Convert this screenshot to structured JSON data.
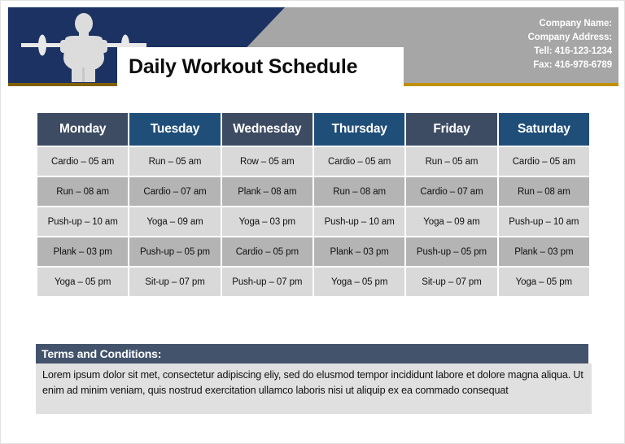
{
  "document": {
    "title": "Daily Workout Schedule"
  },
  "header": {
    "logo_icon": "weightlifter-barbell-icon",
    "company": {
      "name_label": "Company Name:",
      "address_label": "Company Address:",
      "tel": "Tell: 416-123-1234",
      "fax": "Fax: 416-978-6789"
    },
    "colors": {
      "navy": "#1b3263",
      "gray": "#a6a6a6",
      "gold": "#bf9000"
    }
  },
  "schedule": {
    "columns": [
      {
        "label": "Monday",
        "style": "slate"
      },
      {
        "label": "Tuesday",
        "style": "blue"
      },
      {
        "label": "Wednesday",
        "style": "slate"
      },
      {
        "label": "Thursday",
        "style": "blue"
      },
      {
        "label": "Friday",
        "style": "slate"
      },
      {
        "label": "Saturday",
        "style": "blue"
      }
    ],
    "rows": [
      {
        "shade": "light",
        "cells": [
          "Cardio – 05 am",
          "Run – 05 am",
          "Row – 05 am",
          "Cardio – 05 am",
          "Run – 05 am",
          "Cardio – 05 am"
        ]
      },
      {
        "shade": "dark",
        "cells": [
          "Run – 08 am",
          "Cardio – 07 am",
          "Plank – 08 am",
          "Run – 08 am",
          "Cardio – 07 am",
          "Run – 08 am"
        ]
      },
      {
        "shade": "light",
        "cells": [
          "Push-up – 10 am",
          "Yoga – 09 am",
          "Yoga – 03 pm",
          "Push-up – 10 am",
          "Yoga – 09 am",
          "Push-up – 10 am"
        ]
      },
      {
        "shade": "dark",
        "cells": [
          "Plank – 03 pm",
          "Push-up – 05 pm",
          "Cardio – 05 pm",
          "Plank – 03 pm",
          "Push-up – 05 pm",
          "Plank – 03 pm"
        ]
      },
      {
        "shade": "light",
        "cells": [
          "Yoga – 05 pm",
          "Sit-up – 07 pm",
          "Push-up – 07 pm",
          "Yoga – 05 pm",
          "Sit-up – 07 pm",
          "Yoga – 05 pm"
        ]
      }
    ],
    "colors": {
      "header_slate": "#3d4c63",
      "header_blue": "#1f4e79",
      "row_light": "#d9d9d9",
      "row_dark": "#b4b4b4"
    }
  },
  "terms": {
    "heading": "Terms and Conditions:",
    "body": "Lorem ipsum dolor sit met,  consectetur adipiscing eliy, sed do elusmod tempor incididunt labore et dolore magna aliqua. Ut enim ad minim veniam, quis nostrud exercitation ullamco laboris nisi ut aliquip ex ea commado consequat"
  }
}
